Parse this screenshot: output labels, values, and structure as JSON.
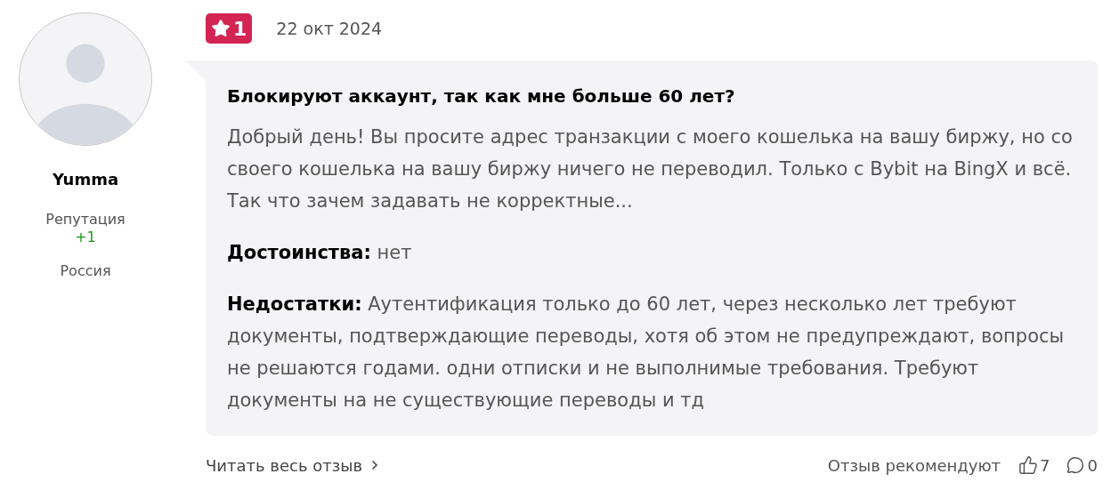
{
  "author": {
    "name": "Yumma",
    "reputation_label": "Репутация",
    "reputation": "+1",
    "country": "Россия"
  },
  "review": {
    "rating": "1",
    "date": "22 окт 2024",
    "title": "Блокируют аккаунт, так как мне больше 60 лет?",
    "text": "Добрый день! Вы просите адрес транзакции с моего кошелька на вашу биржу, но со своего кошелька на вашу биржу ничего не переводил. Только с Bybit на BingX и всё. Так что зачем задавать не корректные...",
    "sections": [
      {
        "label": "Достоинства:",
        "text": "нет"
      },
      {
        "label": "Недостатки:",
        "text": "Аутентификация только до 60 лет, через несколько лет требуют документы, подтверждающие переводы, хотя об этом не предупреждают, вопросы не решаются годами. одни отписки и не выполнимые требования. Требуют документы на не существующие переводы и тд"
      }
    ]
  },
  "footer": {
    "read_more": "Читать весь отзыв",
    "recommend_label": "Отзыв рекомендуют",
    "likes": "7",
    "comments": "0"
  }
}
